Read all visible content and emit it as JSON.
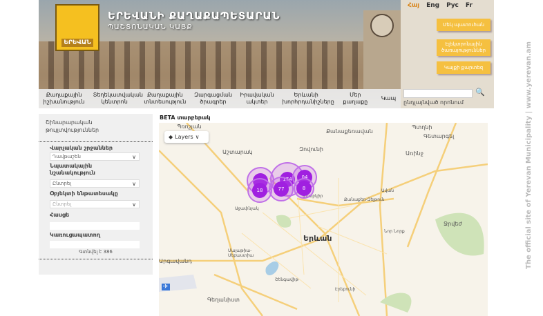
{
  "header": {
    "title": "ԵՐԵՎԱՆԻ ՔԱՂԱՔԱՊԵՏԱՐԱՆ",
    "subtitle": "ՊԱՇՏՈՆԱԿԱՆ ԿԱՅՔ",
    "logo_text": "ԵՐԵՎԱՆ"
  },
  "nav": [
    {
      "label": "Քաղաքային իշխանություն"
    },
    {
      "label": "Տեղեկատվական կենտրոն"
    },
    {
      "label": "Քաղաքային տնտեսություն"
    },
    {
      "label": "Զարգացման ծրագրեր"
    },
    {
      "label": "Իրավական ակտեր"
    },
    {
      "label": "Երևանի խորհրդանիշները"
    },
    {
      "label": "Մեր քաղաքը"
    },
    {
      "label": "Կապ"
    }
  ],
  "languages": [
    {
      "label": "Հայ",
      "active": true
    },
    {
      "label": "Eng"
    },
    {
      "label": "Рус"
    },
    {
      "label": "Fr"
    }
  ],
  "quick_buttons": [
    {
      "label": "Մեկ պատուհան"
    },
    {
      "label": "Էլեկտրոնային ծառայություններ"
    },
    {
      "label": "Կայքի քարտեզ"
    }
  ],
  "search": {
    "value": "",
    "advanced_label": "ընդլայնված որոնում",
    "icon": "search-icon"
  },
  "sidebar": {
    "title": "Շինարարական թույլտվություններ",
    "district_label": "Վարչական շրջաններ",
    "district_value": "Դավթաշեն",
    "purpose_label": "Նպատակային նշանակություն",
    "purpose_value": "Ընտրել",
    "subtype_label": "Օբյեկտի ենթատեսակը",
    "subtype_value": "Ընտրել",
    "address_label": "Հասցե",
    "address_value": "",
    "developer_label": "Կառուցապատող",
    "developer_value": "",
    "find_label": "Գտնվել է 386"
  },
  "map": {
    "beta_label": "BETA տարբերակ",
    "layers_label": "Layers",
    "clusters": [
      "",
      "174",
      "04",
      "18",
      "77",
      "8"
    ],
    "cluster_color": "#a020e0",
    "place_labels": [
      "Պտղնի",
      "Քանաքեռավան",
      "Գետարգել",
      "Զովունի",
      "Առինջ",
      "Աշտարակ",
      "Ավան",
      "Քանաքեռ-Զեյթուն",
      "Արաբկիր",
      "Աջափնյակ",
      "Երևան",
      "Նոր Նորք",
      "Ջրվեժ",
      "Մալաթիա-Սեբաստիա",
      "Արգավանդ",
      "Շենգավիթ",
      "Գեղանիստ",
      "Էրեբունի",
      "Պռոշյան"
    ]
  },
  "side_text": "The official site of Yerevan Municipality  |  www.yerevan.am"
}
